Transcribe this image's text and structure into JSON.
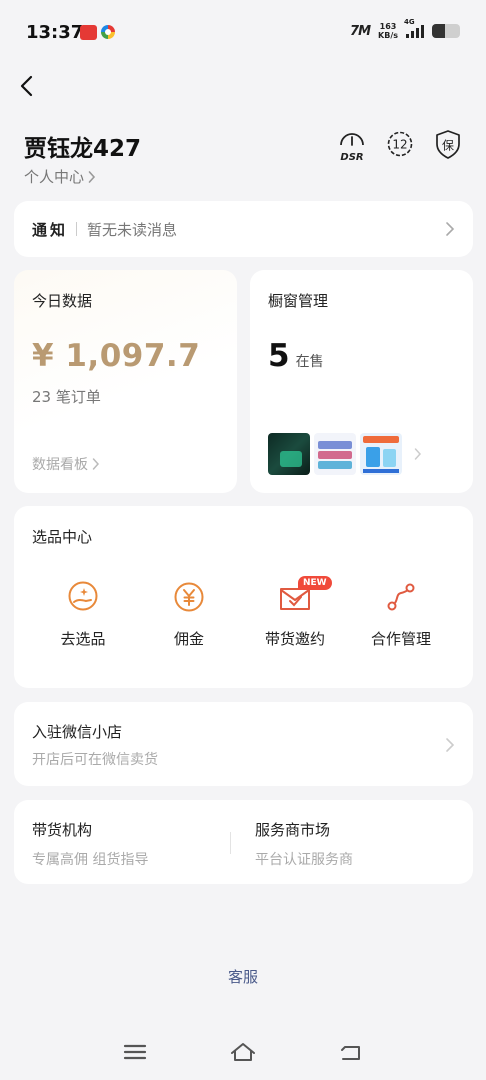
{
  "status_bar": {
    "time": "13:37",
    "net_brand": "7M",
    "speed_value": "163",
    "speed_unit": "KB/s",
    "network_type": "4G"
  },
  "header": {
    "user_name": "贾钰龙427",
    "user_center_label": "个人中心",
    "icons": [
      "dsr-gauge-icon",
      "level-12-icon",
      "guarantee-shield-icon"
    ],
    "dsr_label": "DSR",
    "level_value": "12",
    "guarantee_label": "保"
  },
  "notice": {
    "title": "通知",
    "message": "暂无未读消息"
  },
  "today": {
    "title": "今日数据",
    "amount": "¥ 1,097.7",
    "orders": "23 笔订单",
    "link": "数据看板"
  },
  "window": {
    "title": "橱窗管理",
    "count": "5",
    "count_label": "在售"
  },
  "select_center": {
    "title": "选品中心",
    "items": [
      {
        "label": "去选品",
        "icon": "hand-select-icon"
      },
      {
        "label": "佣金",
        "icon": "yen-coin-icon"
      },
      {
        "label": "带货邀约",
        "icon": "mail-check-icon",
        "badge": "NEW"
      },
      {
        "label": "合作管理",
        "icon": "route-nodes-icon"
      }
    ]
  },
  "wechat_store": {
    "title": "入驻微信小店",
    "subtitle": "开店后可在微信卖货"
  },
  "agency": {
    "left_title": "带货机构",
    "left_subtitle": "专属高佣 组货指导",
    "right_title": "服务商市场",
    "right_subtitle": "平台认证服务商"
  },
  "footer": {
    "service_label": "客服"
  },
  "colors": {
    "accent_orange": "#e8893a",
    "amount_gold": "#b99a72",
    "badge_red": "#f04a3a",
    "link_blue": "#4a5a8a",
    "background": "#f4f4f6"
  }
}
